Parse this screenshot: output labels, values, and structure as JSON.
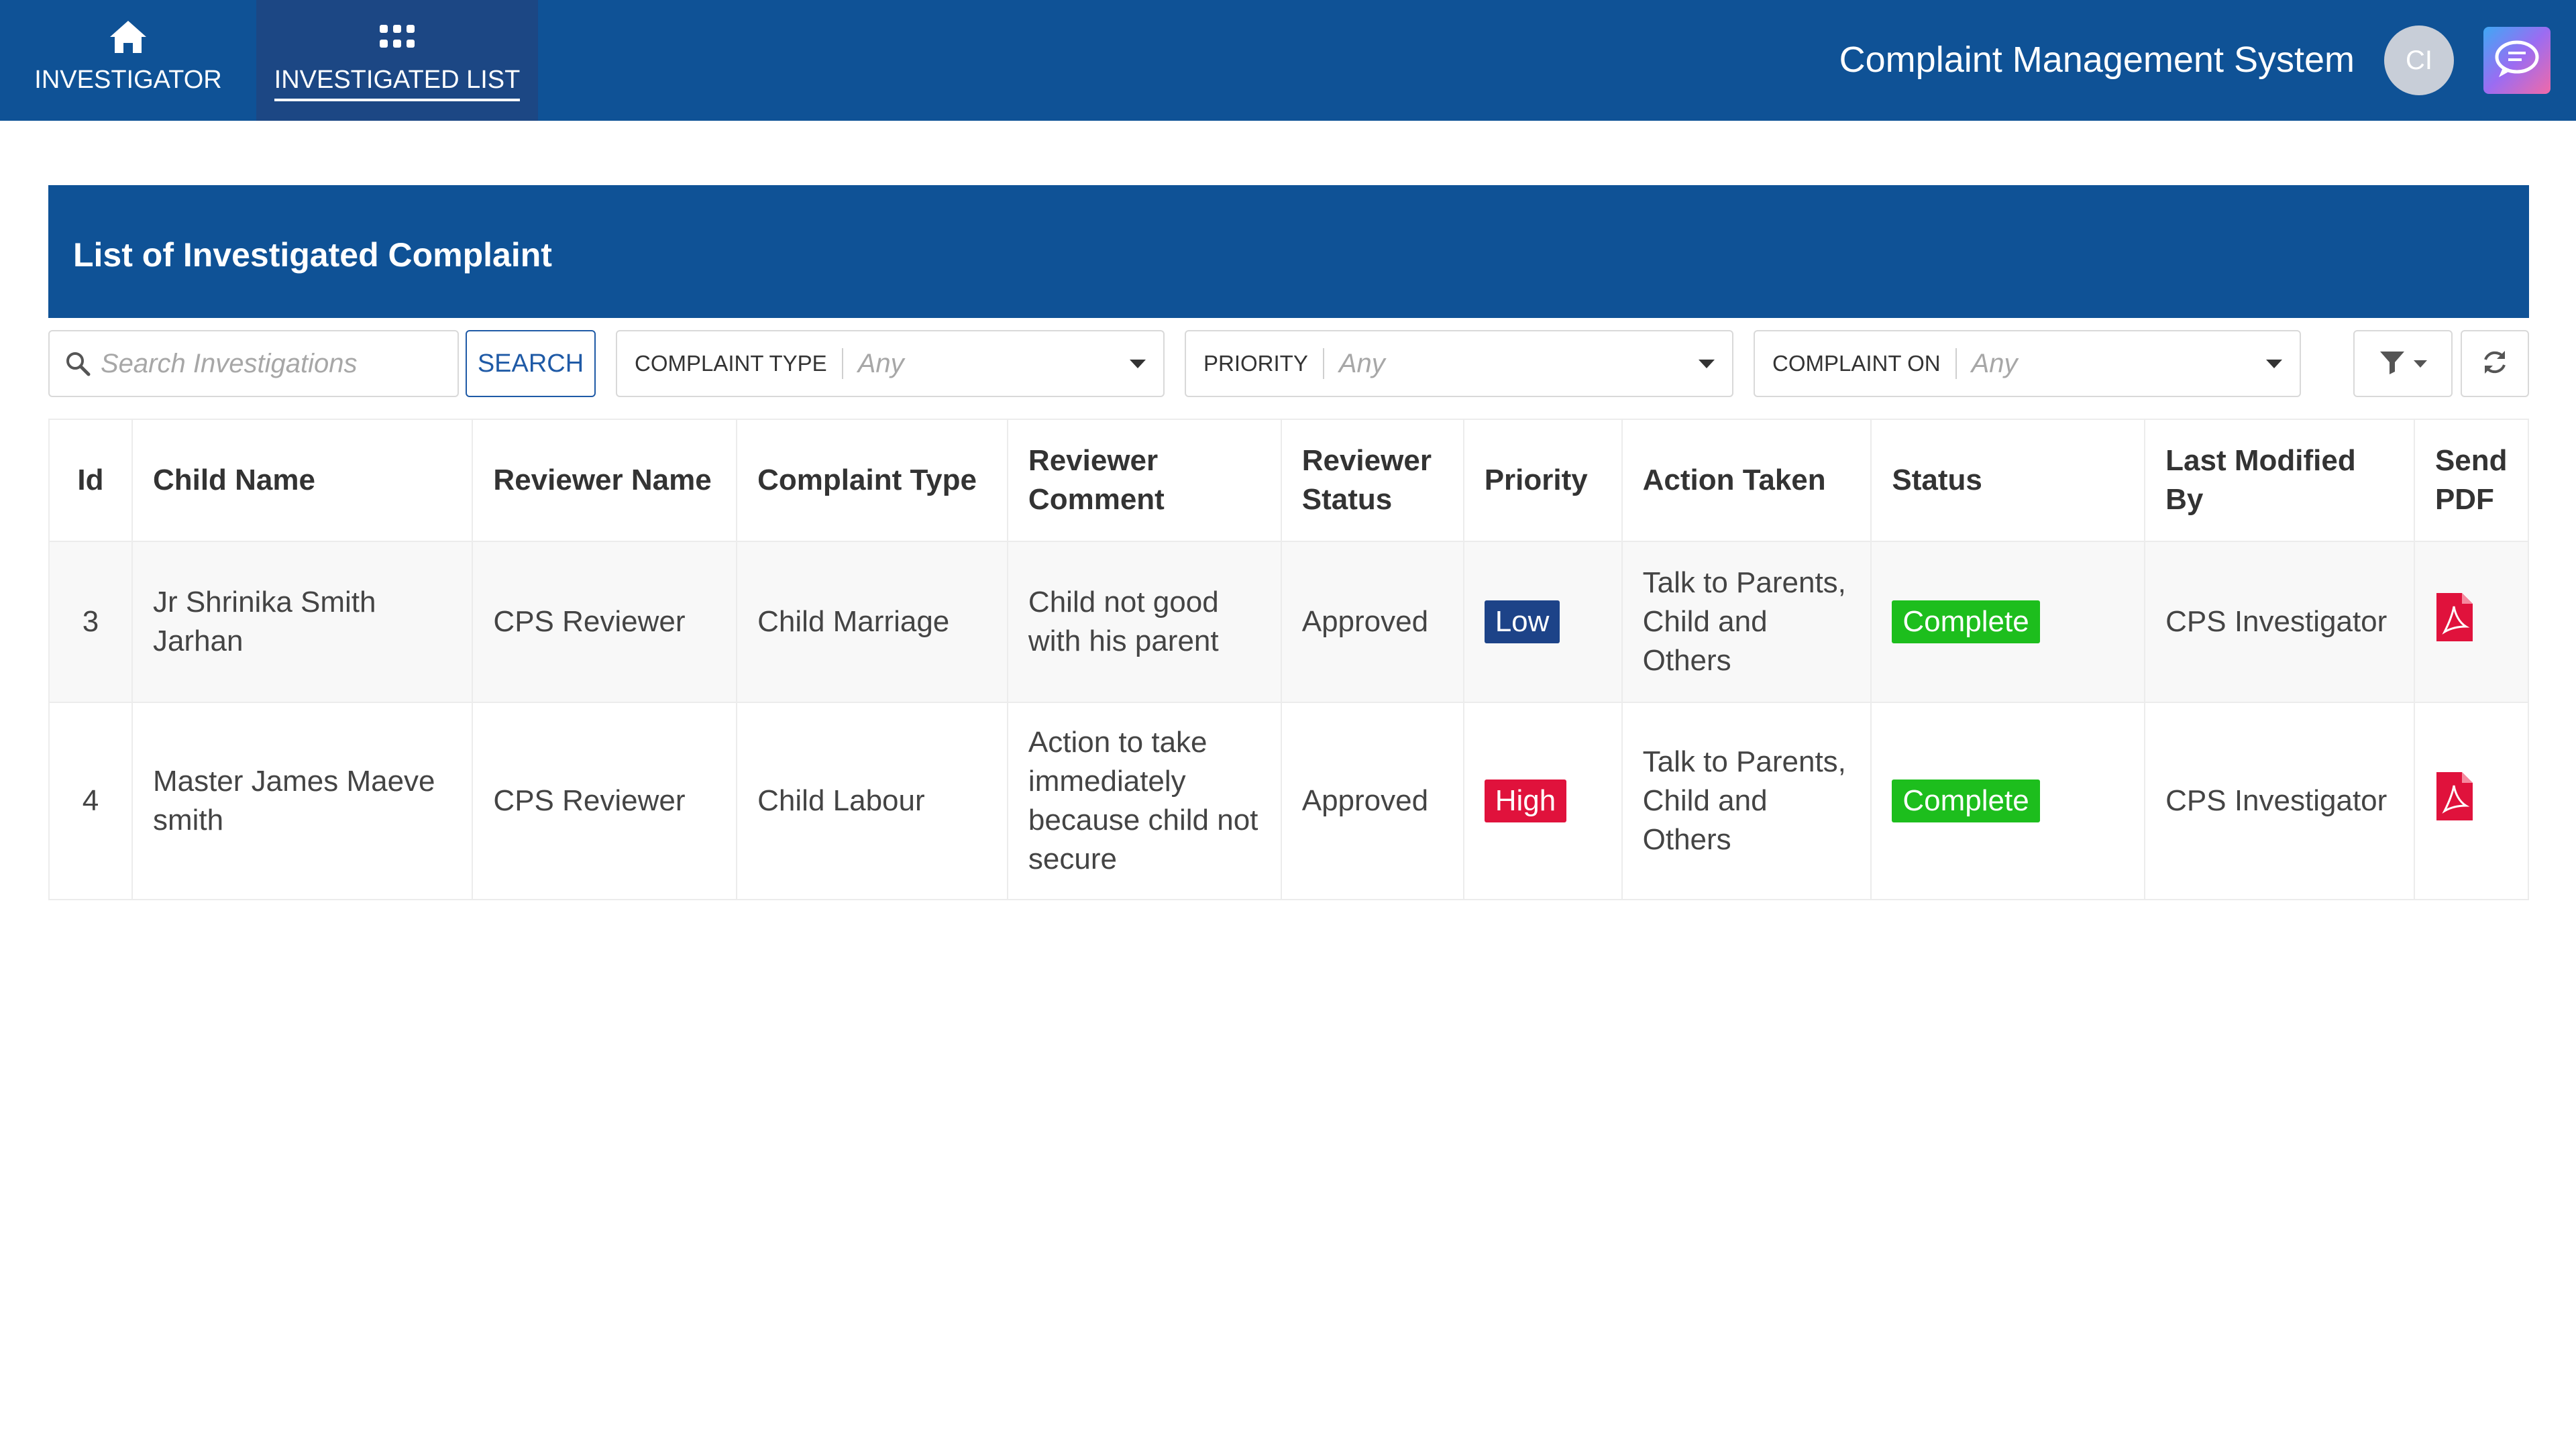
{
  "nav": {
    "items": [
      {
        "label": "INVESTIGATOR",
        "icon": "home-icon"
      },
      {
        "label": "INVESTIGATED LIST",
        "icon": "grid-icon",
        "active": true
      }
    ]
  },
  "header": {
    "app_title": "Complaint Management System",
    "avatar_initials": "CI"
  },
  "panel": {
    "title": "List of Investigated Complaint"
  },
  "filters": {
    "search_placeholder": "Search Investigations",
    "search_label": "SEARCH",
    "complaint_type": {
      "label": "COMPLAINT TYPE",
      "value": "Any"
    },
    "priority": {
      "label": "PRIORITY",
      "value": "Any"
    },
    "complaint_on": {
      "label": "COMPLAINT ON",
      "value": "Any"
    }
  },
  "table": {
    "columns": [
      "Id",
      "Child Name",
      "Reviewer Name",
      "Complaint Type",
      "Reviewer Comment",
      "Reviewer Status",
      "Priority",
      "Action Taken",
      "Status",
      "Last Modified By",
      "Send PDF"
    ],
    "rows": [
      {
        "id": "3",
        "child_name": "Jr Shrinika Smith Jarhan",
        "reviewer_name": "CPS Reviewer",
        "complaint_type": "Child Marriage",
        "reviewer_comment": "Child not  good with his parent",
        "reviewer_status": "Approved",
        "priority": "Low",
        "action_taken": "Talk to Parents, Child and Others",
        "status": "Complete",
        "last_modified_by": "CPS Investigator"
      },
      {
        "id": "4",
        "child_name": "Master James Maeve smith",
        "reviewer_name": "CPS Reviewer",
        "complaint_type": "Child Labour",
        "reviewer_comment": "Action to take immediately because child not secure",
        "reviewer_status": "Approved",
        "priority": "High",
        "action_taken": "Talk to Parents, Child and Others",
        "status": "Complete",
        "last_modified_by": "CPS Investigator"
      }
    ]
  },
  "colors": {
    "primary": "#0f5296",
    "nav_active": "#1c4784",
    "priority_low": "#1d4388",
    "priority_high": "#e0123c",
    "status_complete": "#1dbe1d",
    "pdf_icon": "#e0123c"
  }
}
